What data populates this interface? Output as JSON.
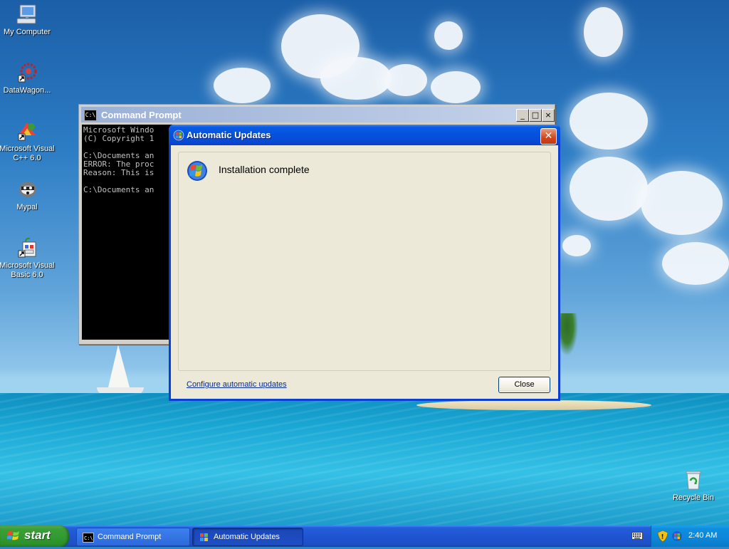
{
  "desktop": {
    "icons": [
      {
        "label": "My Computer",
        "icon": "my-computer-icon"
      },
      {
        "label": "DataWagon...",
        "icon": "datawagon-icon"
      },
      {
        "label": "Microsoft Visual C++ 6.0",
        "icon": "visual-cpp-icon"
      },
      {
        "label": "Mypal",
        "icon": "mypal-icon"
      },
      {
        "label": "Microsoft Visual Basic 6.0",
        "icon": "visual-basic-icon"
      },
      {
        "label": "Recycle Bin",
        "icon": "recycle-bin-icon"
      }
    ]
  },
  "cmd_window": {
    "title": "Command Prompt",
    "console_text": "Microsoft Windo\n(C) Copyright 1\n\nC:\\Documents an\nERROR: The proc\nReason: This is\n\nC:\\Documents an"
  },
  "updates_dialog": {
    "title": "Automatic Updates",
    "heading": "Installation complete",
    "configure_link": "Configure automatic updates",
    "close_button": "Close"
  },
  "taskbar": {
    "start_label": "start",
    "tasks": [
      {
        "label": "Command Prompt",
        "icon": "command-prompt-icon",
        "active": false
      },
      {
        "label": "Automatic Updates",
        "icon": "windows-update-icon",
        "active": true
      }
    ],
    "clock": "2:40 AM"
  },
  "colors": {
    "titlebar_active": "#0453dd",
    "titlebar_inactive": "#9ab0d6",
    "dialog_face": "#ece9d8",
    "taskbar": "#245edb",
    "start_green": "#3c9f38",
    "link": "#0a2d8c"
  }
}
